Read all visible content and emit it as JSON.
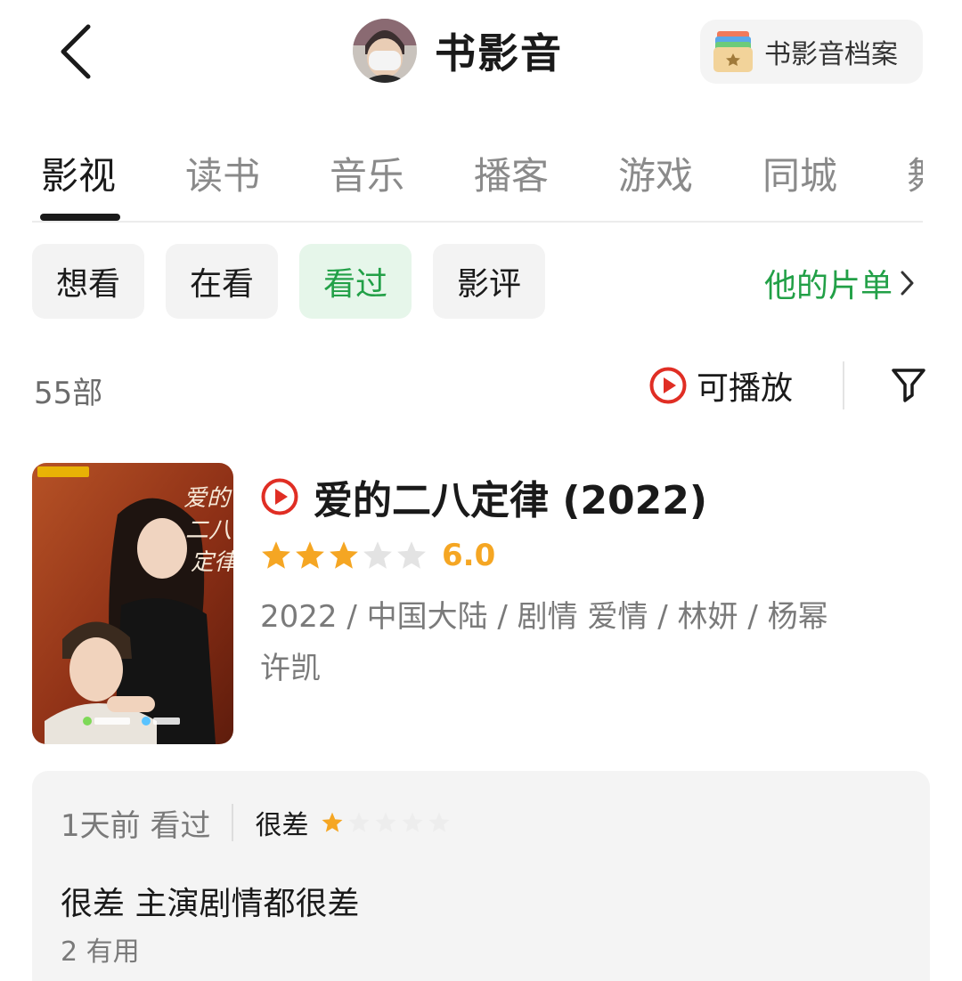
{
  "header": {
    "title": "书影音",
    "archive_label": "书影音档案"
  },
  "tabs": [
    {
      "label": "影视",
      "active": true
    },
    {
      "label": "读书",
      "active": false
    },
    {
      "label": "音乐",
      "active": false
    },
    {
      "label": "播客",
      "active": false
    },
    {
      "label": "游戏",
      "active": false
    },
    {
      "label": "同城",
      "active": false
    },
    {
      "label": "舞",
      "active": false
    }
  ],
  "chips": [
    {
      "label": "想看",
      "active": false
    },
    {
      "label": "在看",
      "active": false
    },
    {
      "label": "看过",
      "active": true
    },
    {
      "label": "影评",
      "active": false
    }
  ],
  "list_link": {
    "label": "他的片单",
    "icon": "chevron-right-icon"
  },
  "filter_row": {
    "count": "55部",
    "playable_label": "可播放",
    "filter_icon": "funnel-icon"
  },
  "movie": {
    "title": "爱的二八定律 (2022)",
    "rating_stars": 3,
    "rating_max": 5,
    "rating_score": "6.0",
    "meta_line1": "2022 / 中国大陆 / 剧情 爱情 / 林妍 / 杨幂",
    "meta_line2": "许凯",
    "poster_title_chars": "爱的二八定律"
  },
  "review": {
    "date": "1天前 看过",
    "grade": "很差",
    "stars": 1,
    "stars_max": 5,
    "text": "很差 主演剧情都很差",
    "useful": "2 有用"
  },
  "colors": {
    "accent_green": "#22a047",
    "chip_active_bg": "#e6f6ea",
    "star_orange": "#f5a623",
    "play_red": "#e02e24"
  }
}
